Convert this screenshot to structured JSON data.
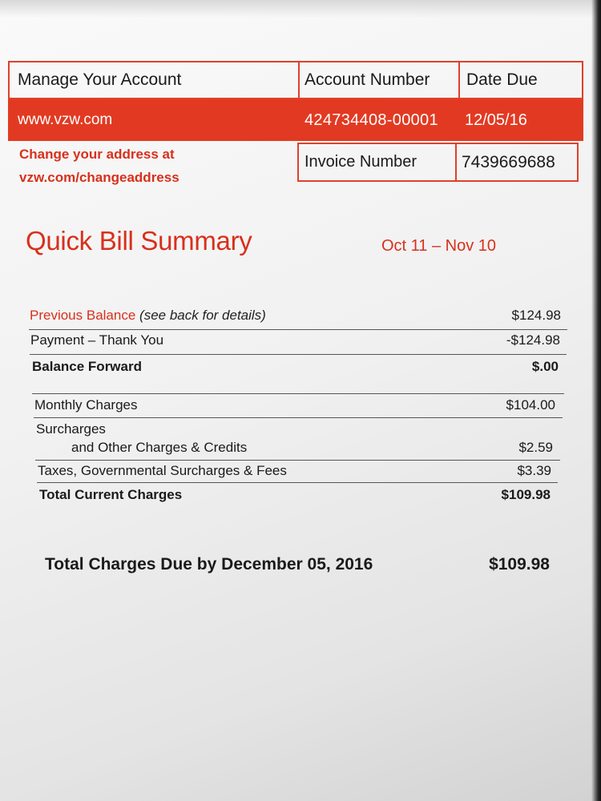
{
  "header": {
    "manage_label": "Manage Your Account",
    "account_number_label": "Account Number",
    "date_due_label": "Date Due",
    "website": "www.vzw.com",
    "account_number": "424734408-00001",
    "date_due": "12/05/16",
    "change_address_line1": "Change your address at",
    "change_address_line2": "vzw.com/changeaddress",
    "invoice_number_label": "Invoice Number",
    "invoice_number": "7439669688"
  },
  "summary": {
    "title": "Quick Bill Summary",
    "period": "Oct 11 – Nov 10",
    "previous_balance_label": "Previous Balance",
    "previous_balance_note": "(see back for details)",
    "previous_balance": "$124.98",
    "payment_label": "Payment – Thank You",
    "payment": "-$124.98",
    "balance_forward_label": "Balance Forward",
    "balance_forward": "$.00",
    "monthly_label": "Monthly Charges",
    "monthly": "$104.00",
    "surcharges_label": "Surcharges",
    "surcharges_sub_label": "and Other Charges & Credits",
    "surcharges": "$2.59",
    "taxes_label": "Taxes, Governmental Surcharges & Fees",
    "taxes": "$3.39",
    "total_current_label": "Total Current Charges",
    "total_current": "$109.98",
    "total_due_label": "Total Charges Due by December 05, 2016",
    "total_due": "$109.98"
  },
  "colors": {
    "brand_red": "#e23a22",
    "text_red": "#d8301c"
  }
}
